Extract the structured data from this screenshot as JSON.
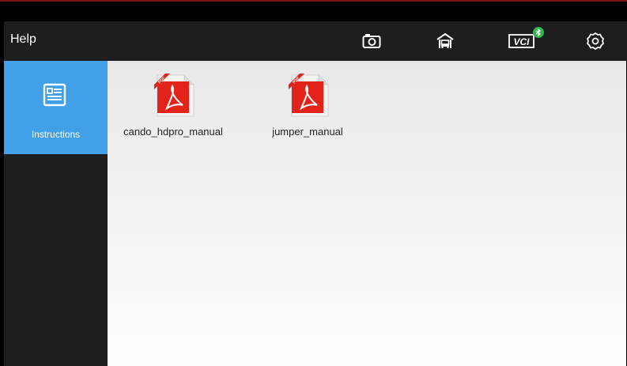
{
  "header": {
    "title": "Help",
    "icons": [
      "camera-icon",
      "garage-home-icon",
      "vci-icon",
      "bluetooth-icon",
      "settings-gear-icon"
    ],
    "vci_label": "VCI"
  },
  "sidebar": {
    "items": [
      {
        "label": "Instructions",
        "icon": "instructions-doc-icon",
        "selected": true
      }
    ]
  },
  "files": [
    {
      "name": "cando_hdpro_manual",
      "icon": "pdf-file-icon",
      "badge": "PDF"
    },
    {
      "name": "jumper_manual",
      "icon": "pdf-file-icon",
      "badge": "PDF"
    }
  ],
  "colors": {
    "accent": "#41a0e8",
    "topbar_bg": "#1e1e20",
    "bluetooth_badge": "#2fb54a",
    "pdf_red": "#e2231a"
  }
}
